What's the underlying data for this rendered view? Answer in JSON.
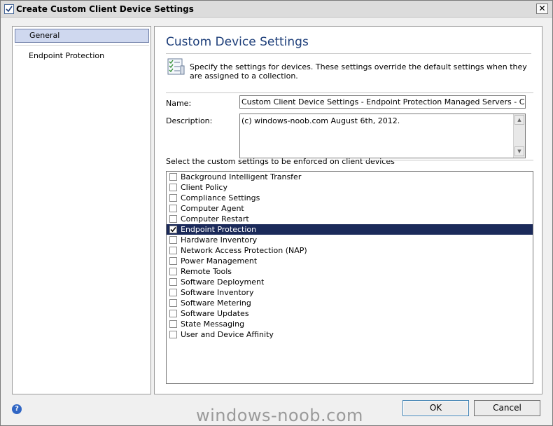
{
  "window": {
    "title": "Create Custom Client Device Settings",
    "close_label": "✕"
  },
  "nav": {
    "items": [
      {
        "label": "General",
        "selected": true
      },
      {
        "label": "Endpoint Protection",
        "selected": false
      }
    ]
  },
  "page": {
    "title": "Custom Device Settings",
    "intro": "Specify the settings for devices. These settings override the default settings when they are assigned to a collection.",
    "icon": "settings-list-icon"
  },
  "form": {
    "name_label": "Name:",
    "name_value": "Custom Client Device Settings - Endpoint Protection Managed Servers - Configuration",
    "description_label": "Description:",
    "description_value": "(c) windows-noob.com August 6th, 2012."
  },
  "settings": {
    "label": "Select the custom settings to be enforced on client devices",
    "items": [
      {
        "label": "Background Intelligent Transfer",
        "checked": false,
        "selected": false
      },
      {
        "label": "Client Policy",
        "checked": false,
        "selected": false
      },
      {
        "label": "Compliance Settings",
        "checked": false,
        "selected": false
      },
      {
        "label": "Computer Agent",
        "checked": false,
        "selected": false
      },
      {
        "label": "Computer Restart",
        "checked": false,
        "selected": false
      },
      {
        "label": "Endpoint Protection",
        "checked": true,
        "selected": true
      },
      {
        "label": "Hardware Inventory",
        "checked": false,
        "selected": false
      },
      {
        "label": "Network Access Protection (NAP)",
        "checked": false,
        "selected": false
      },
      {
        "label": "Power Management",
        "checked": false,
        "selected": false
      },
      {
        "label": "Remote Tools",
        "checked": false,
        "selected": false
      },
      {
        "label": "Software Deployment",
        "checked": false,
        "selected": false
      },
      {
        "label": "Software Inventory",
        "checked": false,
        "selected": false
      },
      {
        "label": "Software Metering",
        "checked": false,
        "selected": false
      },
      {
        "label": "Software Updates",
        "checked": false,
        "selected": false
      },
      {
        "label": "State Messaging",
        "checked": false,
        "selected": false
      },
      {
        "label": "User and Device Affinity",
        "checked": false,
        "selected": false
      }
    ]
  },
  "footer": {
    "help_label": "?",
    "ok_label": "OK",
    "cancel_label": "Cancel",
    "watermark": "windows-noob.com"
  },
  "colors": {
    "selection": "#1b2a5a",
    "title": "#1e3f7a",
    "nav_selected": "#cfd8ef"
  }
}
